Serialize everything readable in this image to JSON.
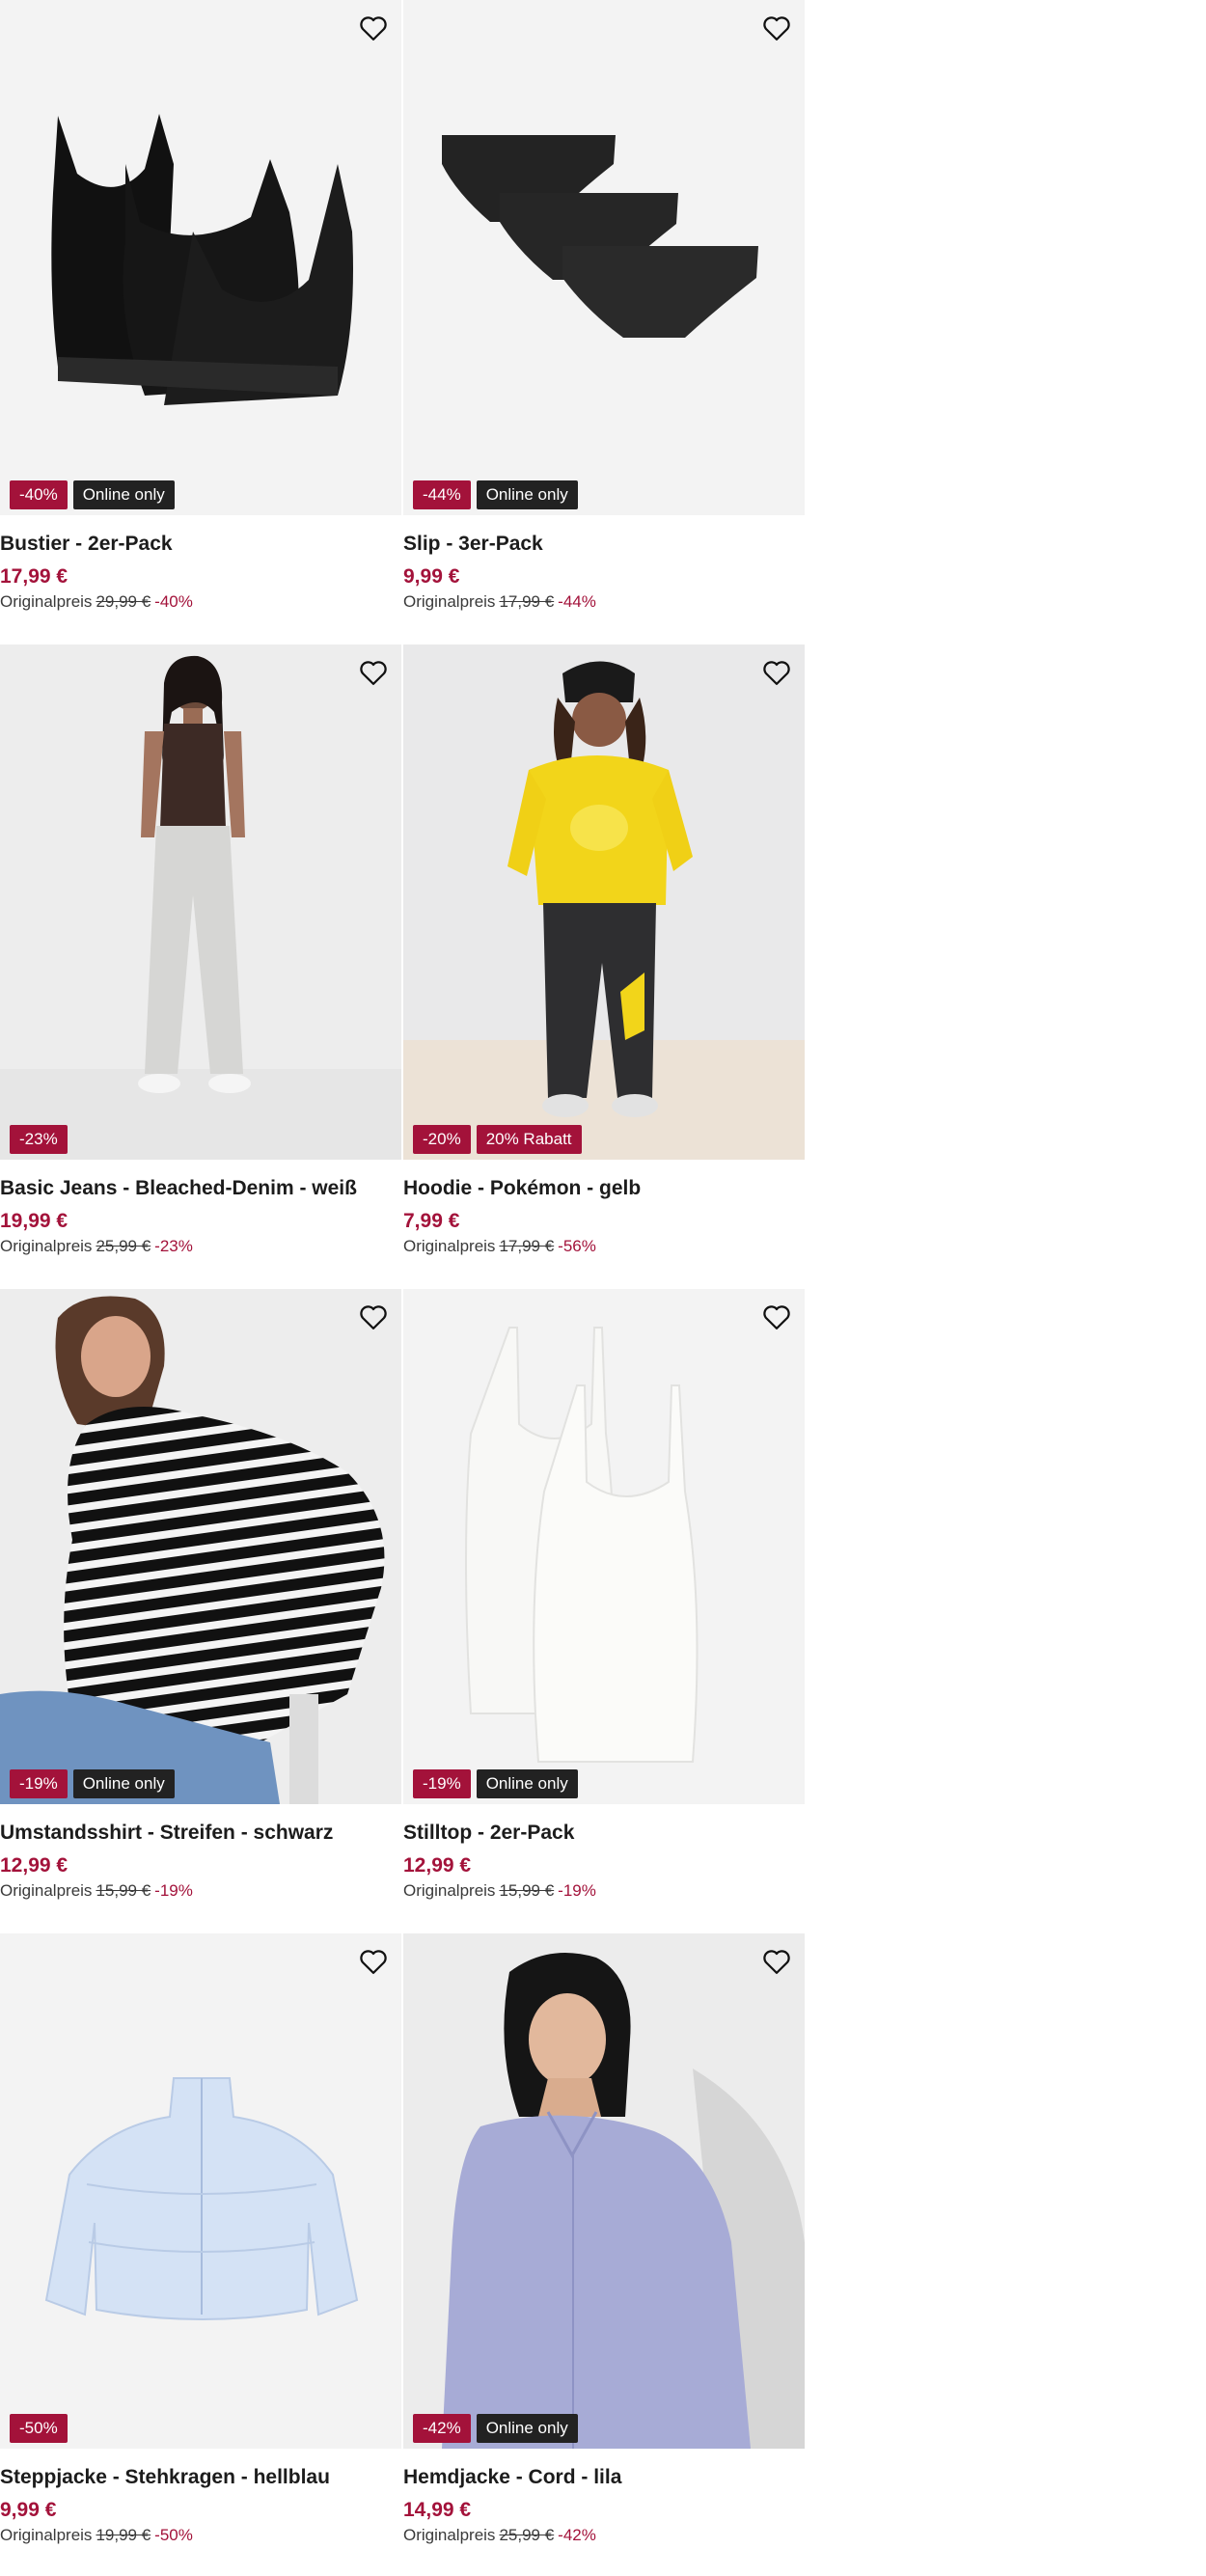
{
  "products": [
    {
      "title": "Bustier - 2er-Pack",
      "price": "17,99 €",
      "orig_label": "Originalpreis",
      "orig_price": "29,99 €",
      "orig_pct": "-40%",
      "badges": [
        {
          "text": "-40%",
          "style": "red"
        },
        {
          "text": "Online only",
          "style": "dark"
        }
      ]
    },
    {
      "title": "Slip - 3er-Pack",
      "price": "9,99 €",
      "orig_label": "Originalpreis",
      "orig_price": "17,99 €",
      "orig_pct": "-44%",
      "badges": [
        {
          "text": "-44%",
          "style": "red"
        },
        {
          "text": "Online only",
          "style": "dark"
        }
      ]
    },
    {
      "title": "Basic Jeans - Bleached-Denim - weiß",
      "price": "19,99 €",
      "orig_label": "Originalpreis",
      "orig_price": "25,99 €",
      "orig_pct": "-23%",
      "badges": [
        {
          "text": "-23%",
          "style": "red"
        }
      ]
    },
    {
      "title": "Hoodie - Pokémon - gelb",
      "price": "7,99 €",
      "orig_label": "Originalpreis",
      "orig_price": "17,99 €",
      "orig_pct": "-56%",
      "badges": [
        {
          "text": "-20%",
          "style": "red"
        },
        {
          "text": "20% Rabatt",
          "style": "red"
        }
      ]
    },
    {
      "title": "Umstandsshirt - Streifen - schwarz",
      "price": "12,99 €",
      "orig_label": "Originalpreis",
      "orig_price": "15,99 €",
      "orig_pct": "-19%",
      "badges": [
        {
          "text": "-19%",
          "style": "red"
        },
        {
          "text": "Online only",
          "style": "dark"
        }
      ]
    },
    {
      "title": "Stilltop - 2er-Pack",
      "price": "12,99 €",
      "orig_label": "Originalpreis",
      "orig_price": "15,99 €",
      "orig_pct": "-19%",
      "badges": [
        {
          "text": "-19%",
          "style": "red"
        },
        {
          "text": "Online only",
          "style": "dark"
        }
      ]
    },
    {
      "title": "Steppjacke - Stehkragen - hellblau",
      "price": "9,99 €",
      "orig_label": "Originalpreis",
      "orig_price": "19,99 €",
      "orig_pct": "-50%",
      "badges": [
        {
          "text": "-50%",
          "style": "red"
        }
      ]
    },
    {
      "title": "Hemdjacke - Cord - lila",
      "price": "14,99 €",
      "orig_label": "Originalpreis",
      "orig_price": "25,99 €",
      "orig_pct": "-42%",
      "badges": [
        {
          "text": "-42%",
          "style": "red"
        },
        {
          "text": "Online only",
          "style": "dark"
        }
      ]
    }
  ],
  "icons": {
    "wishlist": "heart-outline-icon"
  },
  "colors": {
    "accent": "#a3123a",
    "badge_dark": "#222222",
    "image_bg": "#f3f3f3"
  }
}
